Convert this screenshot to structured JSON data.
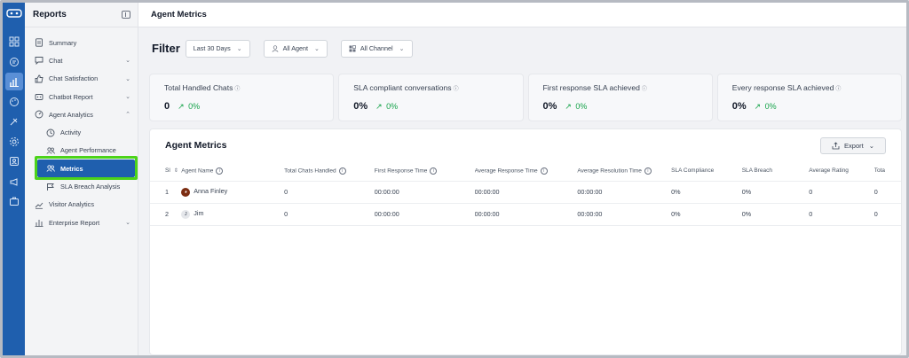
{
  "sidebar": {
    "title": "Reports",
    "items": [
      {
        "label": "Summary",
        "icon": "document-icon",
        "chevron": ""
      },
      {
        "label": "Chat",
        "icon": "chat-icon",
        "chevron": "⌄"
      },
      {
        "label": "Chat Satisfaction",
        "icon": "thumbs-up-icon",
        "chevron": "⌄"
      },
      {
        "label": "Chatbot Report",
        "icon": "bot-icon",
        "chevron": "⌄"
      },
      {
        "label": "Agent Analytics",
        "icon": "gauge-icon",
        "chevron": "⌃"
      },
      {
        "label": "Activity",
        "icon": "clock-icon",
        "chevron": ""
      },
      {
        "label": "Agent Performance",
        "icon": "users-icon",
        "chevron": ""
      },
      {
        "label": "Metrics",
        "icon": "users-icon",
        "chevron": ""
      },
      {
        "label": "SLA Breach Analysis",
        "icon": "flag-icon",
        "chevron": ""
      },
      {
        "label": "Visitor Analytics",
        "icon": "trend-icon",
        "chevron": ""
      },
      {
        "label": "Enterprise Report",
        "icon": "bar-chart-icon",
        "chevron": "⌄"
      }
    ]
  },
  "header": {
    "title": "Agent Metrics"
  },
  "filter": {
    "label": "Filter",
    "date": "Last 30 Days",
    "agent": "All Agent",
    "channel": "All Channel"
  },
  "stats": [
    {
      "title": "Total Handled Chats",
      "value": "0",
      "trend": "0%"
    },
    {
      "title": "SLA compliant conversations",
      "value": "0%",
      "trend": "0%"
    },
    {
      "title": "First response SLA achieved",
      "value": "0%",
      "trend": "0%"
    },
    {
      "title": "Every response SLA achieved",
      "value": "0%",
      "trend": "0%"
    }
  ],
  "table": {
    "title": "Agent Metrics",
    "export_label": "Export",
    "columns": [
      "Sl",
      "Agent Name",
      "Total Chats Handled",
      "First Response Time",
      "Average Response Time",
      "Average Resolution Time",
      "SLA Compliance",
      "SLA Breach",
      "Average Rating",
      "Tota"
    ],
    "rows": [
      {
        "sl": "1",
        "name": "Anna Finley",
        "avatar": "",
        "total": "0",
        "first": "00:00:00",
        "avg_resp": "00:00:00",
        "avg_res": "00:00:00",
        "sla_c": "0%",
        "sla_b": "0%",
        "rating": "0",
        "tota": "0"
      },
      {
        "sl": "2",
        "name": "Jim",
        "avatar": "J",
        "total": "0",
        "first": "00:00:00",
        "avg_resp": "00:00:00",
        "avg_res": "00:00:00",
        "sla_c": "0%",
        "sla_b": "0%",
        "rating": "0",
        "tota": "0"
      }
    ]
  },
  "colors": {
    "brand": "#1f5fae",
    "highlight": "#4cd31a",
    "trend": "#16a34a"
  }
}
